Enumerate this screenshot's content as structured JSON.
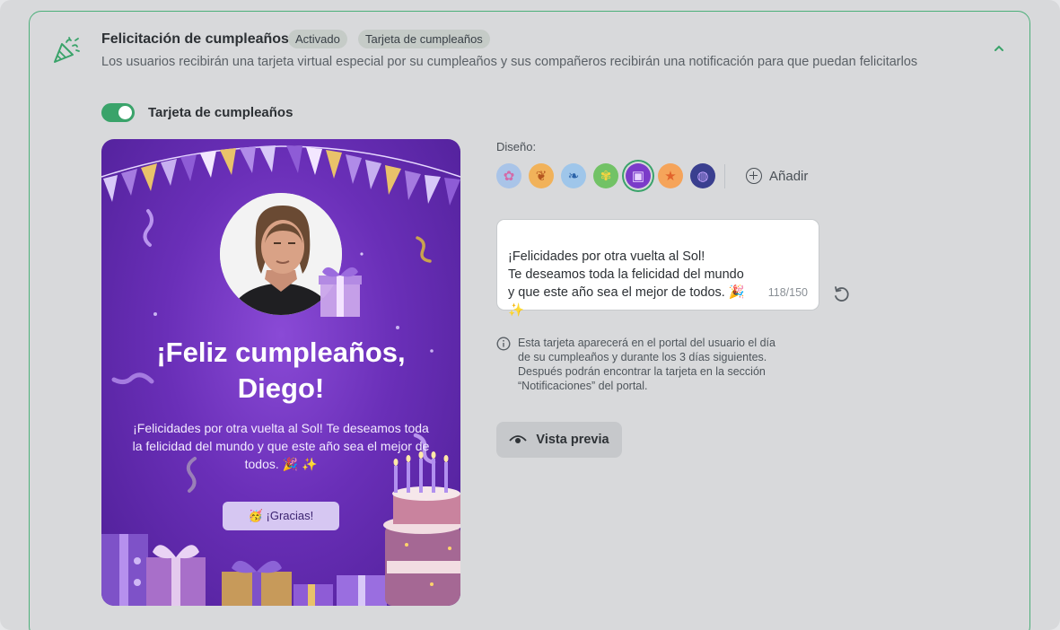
{
  "section": {
    "title": "Felicitación de cumpleaños",
    "badges": [
      "Activado",
      "Tarjeta de cumpleaños"
    ],
    "description": "Los usuarios recibirán una tarjeta virtual especial por su cumpleaños y sus compañeros recibirán una notificación para que puedan felicitarlos",
    "icon": "party-popper-icon",
    "collapse_icon": "chevron-up-icon"
  },
  "toggle": {
    "label": "Tarjeta de cumpleaños",
    "on": true,
    "color": "#3aa36a"
  },
  "card": {
    "title_line1": "¡Feliz cumpleaños,",
    "title_line2": "Diego!",
    "message": "¡Felicidades por otra vuelta al Sol! Te deseamos toda la felicidad del mundo y que este año sea el mejor de todos. 🎉 ✨",
    "thanks_button": "🥳 ¡Gracias!"
  },
  "design": {
    "label": "Diseño:",
    "swatches": [
      {
        "name": "flowers-pink",
        "color": "#a9c4e8",
        "glyph": "✿"
      },
      {
        "name": "autumn-leaf",
        "color": "#f1b25a",
        "glyph": "❦"
      },
      {
        "name": "blue-plant",
        "color": "#9fc6ea",
        "glyph": "❧"
      },
      {
        "name": "yellow-flower",
        "color": "#72c266",
        "glyph": "✾"
      },
      {
        "name": "gift-purple",
        "color": "#7b3bc9",
        "glyph": "▣"
      },
      {
        "name": "starfish",
        "color": "#f5a45a",
        "glyph": "★"
      },
      {
        "name": "planet",
        "color": "#3a3f8f",
        "glyph": "◍"
      }
    ],
    "selected_index": 4,
    "add_label": "Añadir"
  },
  "message_editor": {
    "value": "¡Felicidades por otra vuelta al Sol!\nTe deseamos toda la felicidad del mundo\ny que este año sea el mejor de todos. 🎉\n✨",
    "counter": "118/150"
  },
  "info": {
    "text": "Esta tarjeta aparecerá en el portal del usuario el día de su cumpleaños y durante los 3 días siguientes. Después podrán encontrar la tarjeta en la sección “Notificaciones” del portal."
  },
  "preview_button": "Vista previa"
}
